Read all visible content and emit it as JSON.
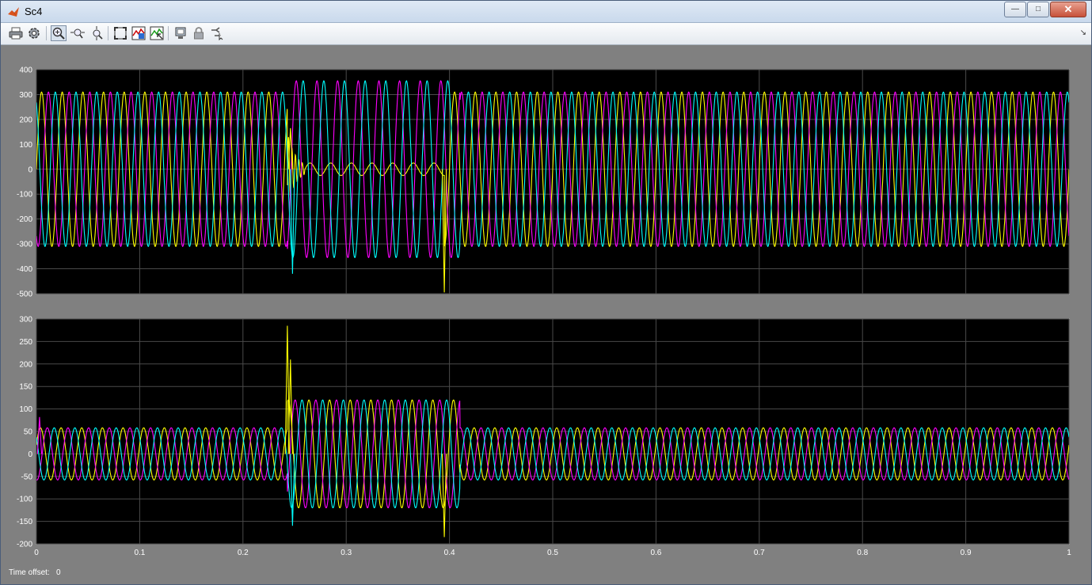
{
  "window": {
    "title": "Sc4",
    "minimize_symbol": "—",
    "maximize_symbol": "□",
    "close_symbol": "✕"
  },
  "toolbar": {
    "buttons": [
      {
        "name": "print-icon"
      },
      {
        "name": "parameters-icon"
      },
      {
        "name": "zoom-in-icon",
        "active": true
      },
      {
        "name": "zoom-x-icon"
      },
      {
        "name": "zoom-y-icon"
      },
      {
        "name": "autoscale-icon"
      },
      {
        "name": "save-axes-icon"
      },
      {
        "name": "restore-axes-icon"
      },
      {
        "name": "floating-scope-icon"
      },
      {
        "name": "lock-axes-icon"
      },
      {
        "name": "signal-selection-icon"
      }
    ],
    "overflow_symbol": "↘"
  },
  "time_offset": {
    "label": "Time offset:",
    "value": "0"
  },
  "chart_data": [
    {
      "type": "line",
      "xlim": [
        0,
        1
      ],
      "ylim": [
        -500,
        400
      ],
      "yticks": [
        400,
        300,
        200,
        100,
        0,
        -100,
        -200,
        -300,
        -400,
        -500
      ],
      "xticks": [],
      "grid": true,
      "background": "#000000",
      "frequency_hz": 50,
      "series": [
        {
          "color": "#ffff00",
          "phase_deg": 0,
          "segments": [
            {
              "t0": 0.0,
              "t1": 0.243,
              "amp": 310
            },
            {
              "t0": 0.243,
              "t1": 0.26,
              "amp": 150,
              "transient": true
            },
            {
              "t0": 0.26,
              "t1": 0.395,
              "amp": 25
            },
            {
              "t0": 0.395,
              "t1": 1.0,
              "amp": 310
            }
          ]
        },
        {
          "color": "#ff00ff",
          "phase_deg": -120,
          "segments": [
            {
              "t0": 0.0,
              "t1": 0.243,
              "amp": 310
            },
            {
              "t0": 0.243,
              "t1": 0.41,
              "amp": 355
            },
            {
              "t0": 0.41,
              "t1": 1.0,
              "amp": 310
            }
          ]
        },
        {
          "color": "#00ffff",
          "phase_deg": 120,
          "segments": [
            {
              "t0": 0.0,
              "t1": 0.243,
              "amp": 310
            },
            {
              "t0": 0.243,
              "t1": 0.41,
              "amp": 355
            },
            {
              "t0": 0.41,
              "t1": 1.0,
              "amp": 310
            }
          ]
        }
      ],
      "spikes": [
        {
          "t": 0.248,
          "y": -420,
          "color": "#00ffff"
        },
        {
          "t": 0.246,
          "y": 165,
          "color": "#ffff00"
        },
        {
          "t": 0.395,
          "y": -495,
          "color": "#ffff00"
        }
      ]
    },
    {
      "type": "line",
      "xlim": [
        0,
        1
      ],
      "ylim": [
        -200,
        300
      ],
      "yticks": [
        300,
        250,
        200,
        150,
        100,
        50,
        0,
        -50,
        -100,
        -150,
        -200
      ],
      "xticks": [
        0,
        0.1,
        0.2,
        0.3,
        0.4,
        0.5,
        0.6,
        0.7,
        0.8,
        0.9,
        1
      ],
      "grid": true,
      "background": "#000000",
      "frequency_hz": 50,
      "series": [
        {
          "color": "#ffff00",
          "phase_deg": 20,
          "segments": [
            {
              "t0": 0.0,
              "t1": 0.243,
              "amp": 58
            },
            {
              "t0": 0.243,
              "t1": 0.41,
              "amp": 120
            },
            {
              "t0": 0.41,
              "t1": 1.0,
              "amp": 58
            }
          ]
        },
        {
          "color": "#ff00ff",
          "phase_deg": -100,
          "segments": [
            {
              "t0": 0.0,
              "t1": 0.243,
              "amp": 58
            },
            {
              "t0": 0.243,
              "t1": 0.41,
              "amp": 120
            },
            {
              "t0": 0.41,
              "t1": 1.0,
              "amp": 58
            }
          ]
        },
        {
          "color": "#00ffff",
          "phase_deg": 140,
          "segments": [
            {
              "t0": 0.0,
              "t1": 0.243,
              "amp": 58
            },
            {
              "t0": 0.243,
              "t1": 0.41,
              "amp": 120
            },
            {
              "t0": 0.41,
              "t1": 1.0,
              "amp": 58
            }
          ]
        }
      ],
      "spikes": [
        {
          "t": 0.243,
          "y": 285,
          "color": "#ffff00"
        },
        {
          "t": 0.246,
          "y": 210,
          "color": "#ffff00"
        },
        {
          "t": 0.248,
          "y": -160,
          "color": "#00ffff"
        },
        {
          "t": 0.395,
          "y": -185,
          "color": "#ffff00"
        },
        {
          "t": 0.003,
          "y": 82,
          "color": "#ff00ff"
        }
      ]
    }
  ]
}
